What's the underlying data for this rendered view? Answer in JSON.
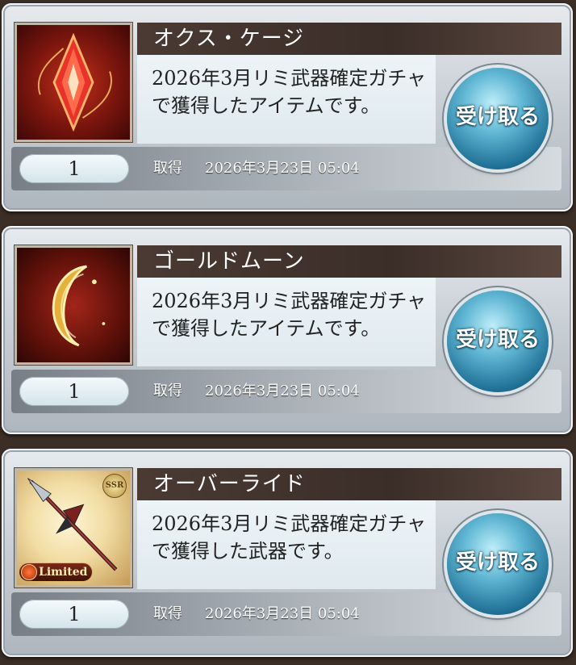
{
  "items": [
    {
      "name": "オクス・ケージ",
      "description": "2026年3月リミ武器確定ガチャで獲得したアイテムです。",
      "count": "1",
      "obtained_label": "取得",
      "obtained_date": "2026年3月23日 05:04",
      "receive_label": "受け取る",
      "icon": "red-crystal-icon"
    },
    {
      "name": "ゴールドムーン",
      "description": "2026年3月リミ武器確定ガチャで獲得したアイテムです。",
      "count": "1",
      "obtained_label": "取得",
      "obtained_date": "2026年3月23日 05:04",
      "receive_label": "受け取る",
      "icon": "gold-moon-icon"
    },
    {
      "name": "オーバーライド",
      "description": "2026年3月リミ武器確定ガチャで獲得した武器です。",
      "count": "1",
      "obtained_label": "取得",
      "obtained_date": "2026年3月23日 05:04",
      "receive_label": "受け取る",
      "icon": "spear-weapon-icon",
      "rarity_badge": "SSR",
      "limited_badge": "Limited"
    }
  ],
  "colors": {
    "title_bar": "#3b2d28",
    "receive_button": "#1e6e93",
    "background": "#3a2e26"
  }
}
